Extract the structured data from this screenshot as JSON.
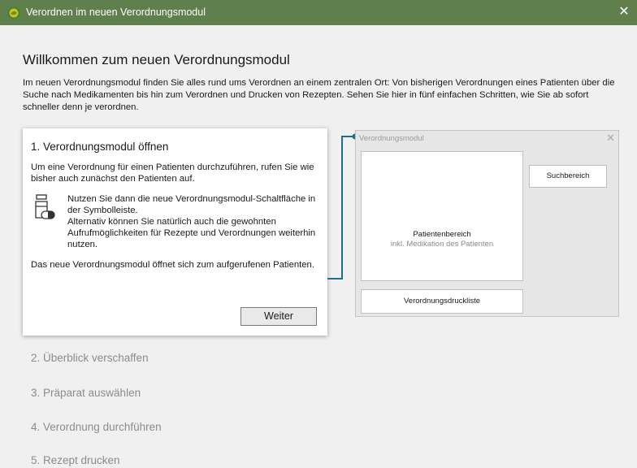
{
  "window": {
    "title": "Verordnen im neuen Verordnungsmodul",
    "close_glyph": "✕"
  },
  "page": {
    "heading": "Willkommen zum neuen Verordnungsmodul",
    "intro": "Im neuen Verordnungsmodul finden Sie alles rund ums Verordnen an einem zentralen Ort: Von bisherigen Verordnungen eines Patienten über die Suche nach Medikamenten bis hin zum Verordnen und Drucken von Rezepten. Sehen Sie hier in fünf einfachen Schritten, wie Sie ab sofort schneller denn je verordnen."
  },
  "active_step": {
    "title": "1. Verordnungsmodul öffnen",
    "paragraph1": "Um eine Verordnung für einen Patienten durchzuführen, rufen Sie wie bisher auch zunächst den Patienten auf.",
    "paragraph2": "Nutzen Sie dann die neue Verordnungsmodul-Schaltfläche in der Symbolleiste.",
    "paragraph2b": "Alternativ können Sie natürlich auch die gewohnten Aufrufmöglichkeiten für Rezepte und Verordnungen weiterhin nutzen.",
    "paragraph3": "Das neue Verordnungsmodul öffnet sich zum aufgerufenen Patienten.",
    "next_button": "Weiter"
  },
  "preview": {
    "title": "Verordnungsmodul",
    "close_glyph": "✕",
    "patient_area": "Patientenbereich",
    "patient_area_sub": "inkl. Medikation des Patienten",
    "search_area": "Suchbereich",
    "print_list": "Verordnungsdruckliste"
  },
  "steps": [
    "2. Überblick verschaffen",
    "3. Präparat auswählen",
    "4. Verordnung durchführen",
    "5. Rezept drucken"
  ],
  "colors": {
    "titlebar": "#5f7f4d",
    "connector": "#1f6f8b"
  },
  "icons": {
    "app": "app-logo-icon",
    "medication": "medication-bottle-icon"
  }
}
